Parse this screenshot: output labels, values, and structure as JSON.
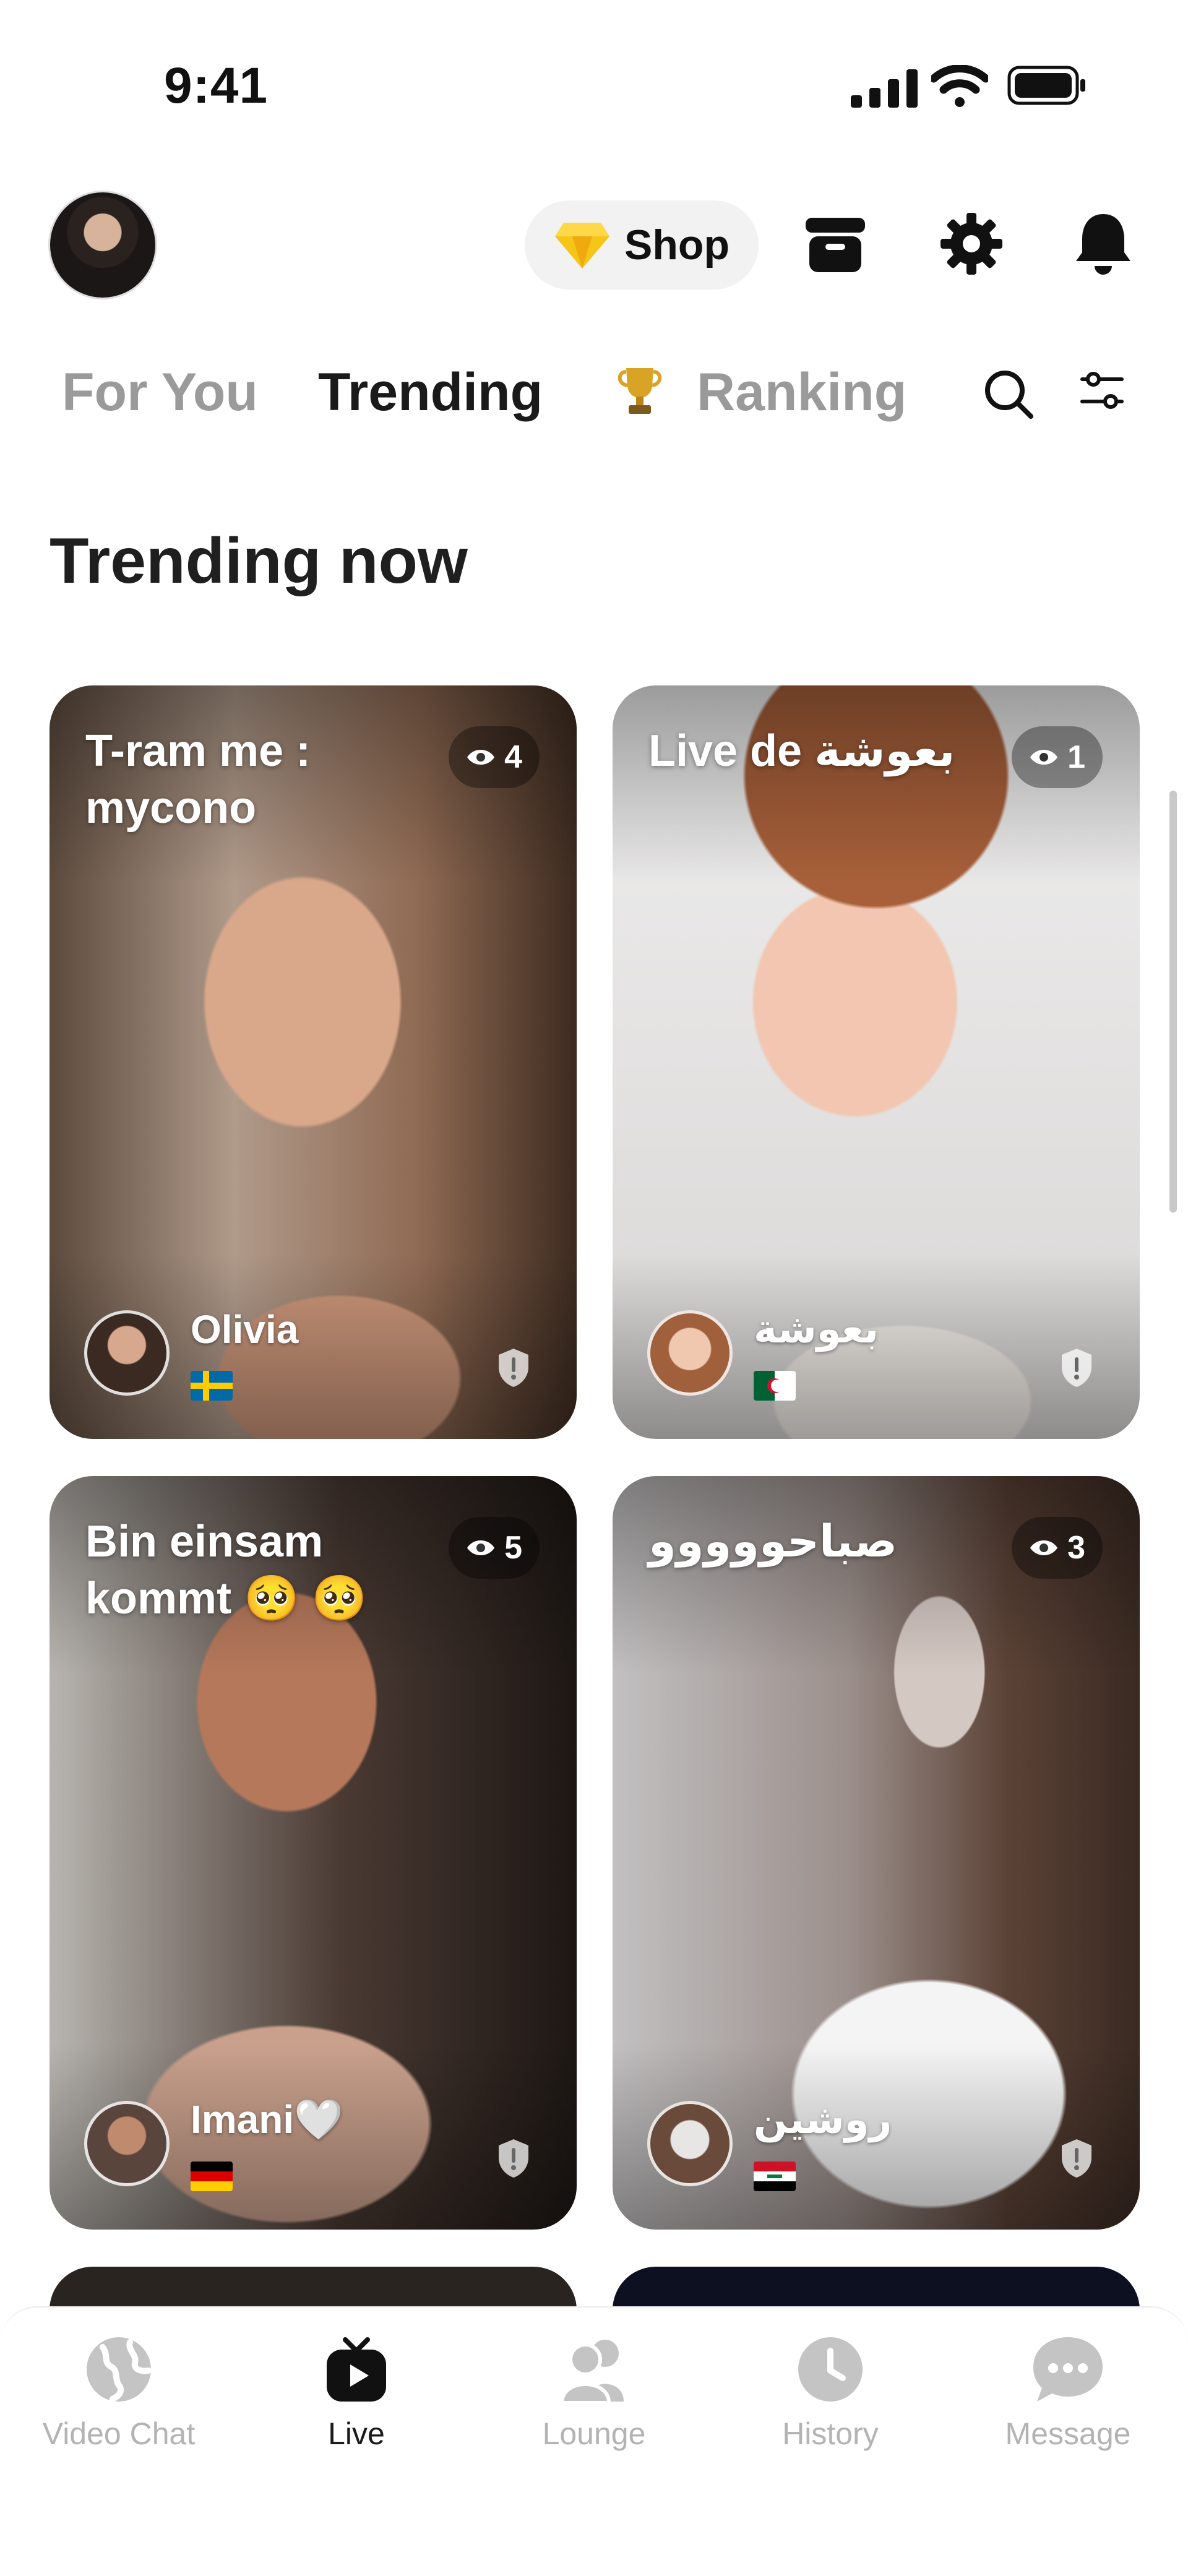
{
  "status_bar": {
    "time": "9:41"
  },
  "header": {
    "shop_label": "Shop",
    "icons": [
      "profile-avatar",
      "diamond-icon",
      "wallet-icon",
      "gear-icon",
      "bell-icon"
    ]
  },
  "tabs": {
    "items": [
      {
        "label": "For You",
        "active": false
      },
      {
        "label": "Trending",
        "active": true
      },
      {
        "label": "Ranking",
        "active": false
      }
    ]
  },
  "section_title": "Trending now",
  "cards": [
    {
      "title": "T-ram me : mycono",
      "viewers": "4",
      "host": "Olivia",
      "flag": "Sweden"
    },
    {
      "title": "Live de بعوشة",
      "viewers": "1",
      "host": "بعوشة",
      "flag": "Algeria"
    },
    {
      "title": "Bin einsam kommt 🥺 🥺",
      "viewers": "5",
      "host": "Imani🤍",
      "flag": "Germany"
    },
    {
      "title": "صباحووووو",
      "viewers": "3",
      "host": "روشين",
      "flag": "Iraq"
    }
  ],
  "bottom_nav": {
    "items": [
      {
        "label": "Video Chat",
        "active": false
      },
      {
        "label": "Live",
        "active": true
      },
      {
        "label": "Lounge",
        "active": false
      },
      {
        "label": "History",
        "active": false
      },
      {
        "label": "Message",
        "active": false
      }
    ]
  },
  "colors": {
    "active": "#1a1a1a",
    "inactive": "#9a9a9a",
    "accent_trophy": "#d9a425"
  }
}
